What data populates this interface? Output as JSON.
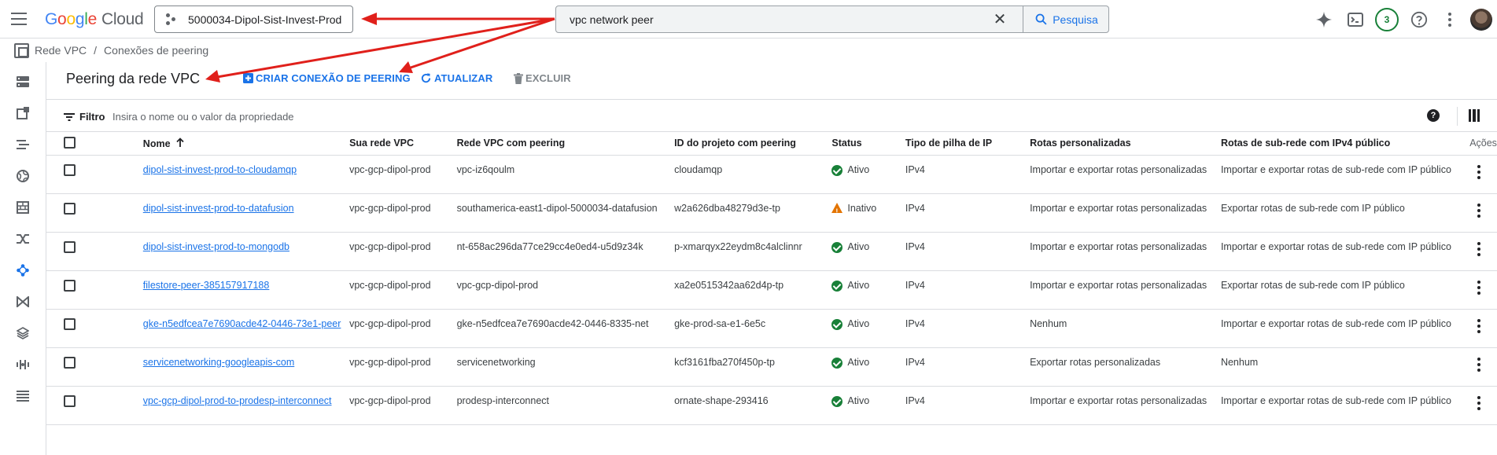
{
  "header": {
    "logo": {
      "g1": "G",
      "g2": "o",
      "g3": "o",
      "g4": "g",
      "g5": "l",
      "g6": "e",
      "cloud": "Cloud"
    },
    "project": "5000034-Dipol-Sist-Invest-Prod",
    "search": {
      "value": "vpc network peer",
      "button": "Pesquisa"
    },
    "notifications_count": "3",
    "icons": [
      "menu-icon",
      "gemini-sparkle-icon",
      "cloud-shell-icon",
      "help-icon",
      "more-vert-icon"
    ]
  },
  "breadcrumb": {
    "root": "Rede VPC",
    "separator": "/",
    "current": "Conexões de peering"
  },
  "page": {
    "title": "Peering da rede VPC",
    "actions": {
      "create": "CRIAR CONEXÃO DE PEERING",
      "refresh": "ATUALIZAR",
      "delete": "EXCLUIR"
    }
  },
  "filter": {
    "label": "Filtro",
    "placeholder": "Insira o nome ou o valor da propriedade"
  },
  "table": {
    "columns": {
      "name": "Nome",
      "your_vpc": "Sua rede VPC",
      "peered_vpc": "Rede VPC com peering",
      "peer_project": "ID do projeto com peering",
      "status": "Status",
      "ip_stack": "Tipo de pilha de IP",
      "custom_routes": "Rotas personalizadas",
      "subnet_routes": "Rotas de sub-rede com IPv4 público",
      "actions": "Ações"
    },
    "rows": [
      {
        "name": "dipol-sist-invest-prod-to-cloudamqp",
        "your_vpc": "vpc-gcp-dipol-prod",
        "peered_vpc": "vpc-iz6qoulm",
        "peer_project": "cloudamqp",
        "status": "Ativo",
        "ok": true,
        "ip_stack": "IPv4",
        "custom_routes": "Importar e exportar rotas personalizadas",
        "subnet_routes": "Importar e exportar rotas de sub-rede com IP público"
      },
      {
        "name": "dipol-sist-invest-prod-to-datafusion",
        "your_vpc": "vpc-gcp-dipol-prod",
        "peered_vpc": "southamerica-east1-dipol-5000034-datafusion",
        "peer_project": "w2a626dba48279d3e-tp",
        "status": "Inativo",
        "ok": false,
        "ip_stack": "IPv4",
        "custom_routes": "Importar e exportar rotas personalizadas",
        "subnet_routes": "Exportar rotas de sub-rede com IP público"
      },
      {
        "name": "dipol-sist-invest-prod-to-mongodb",
        "your_vpc": "vpc-gcp-dipol-prod",
        "peered_vpc": "nt-658ac296da77ce29cc4e0ed4-u5d9z34k",
        "peer_project": "p-xmarqyx22eydm8c4alclinnr",
        "status": "Ativo",
        "ok": true,
        "ip_stack": "IPv4",
        "custom_routes": "Importar e exportar rotas personalizadas",
        "subnet_routes": "Importar e exportar rotas de sub-rede com IP público"
      },
      {
        "name": "filestore-peer-385157917188",
        "your_vpc": "vpc-gcp-dipol-prod",
        "peered_vpc": "vpc-gcp-dipol-prod",
        "peer_project": "xa2e0515342aa62d4p-tp",
        "status": "Ativo",
        "ok": true,
        "ip_stack": "IPv4",
        "custom_routes": "Importar e exportar rotas personalizadas",
        "subnet_routes": "Exportar rotas de sub-rede com IP público"
      },
      {
        "name": "gke-n5edfcea7e7690acde42-0446-73e1-peer",
        "your_vpc": "vpc-gcp-dipol-prod",
        "peered_vpc": "gke-n5edfcea7e7690acde42-0446-8335-net",
        "peer_project": "gke-prod-sa-e1-6e5c",
        "status": "Ativo",
        "ok": true,
        "ip_stack": "IPv4",
        "custom_routes": "Nenhum",
        "subnet_routes": "Importar e exportar rotas de sub-rede com IP público"
      },
      {
        "name": "servicenetworking-googleapis-com",
        "your_vpc": "vpc-gcp-dipol-prod",
        "peered_vpc": "servicenetworking",
        "peer_project": "kcf3161fba270f450p-tp",
        "status": "Ativo",
        "ok": true,
        "ip_stack": "IPv4",
        "custom_routes": "Exportar rotas personalizadas",
        "subnet_routes": "Nenhum"
      },
      {
        "name": "vpc-gcp-dipol-prod-to-prodesp-interconnect",
        "your_vpc": "vpc-gcp-dipol-prod",
        "peered_vpc": "prodesp-interconnect",
        "peer_project": "ornate-shape-293416",
        "status": "Ativo",
        "ok": true,
        "ip_stack": "IPv4",
        "custom_routes": "Importar e exportar rotas personalizadas",
        "subnet_routes": "Importar e exportar rotas de sub-rede com IP público"
      }
    ]
  },
  "annotation_color": "#e0201b"
}
